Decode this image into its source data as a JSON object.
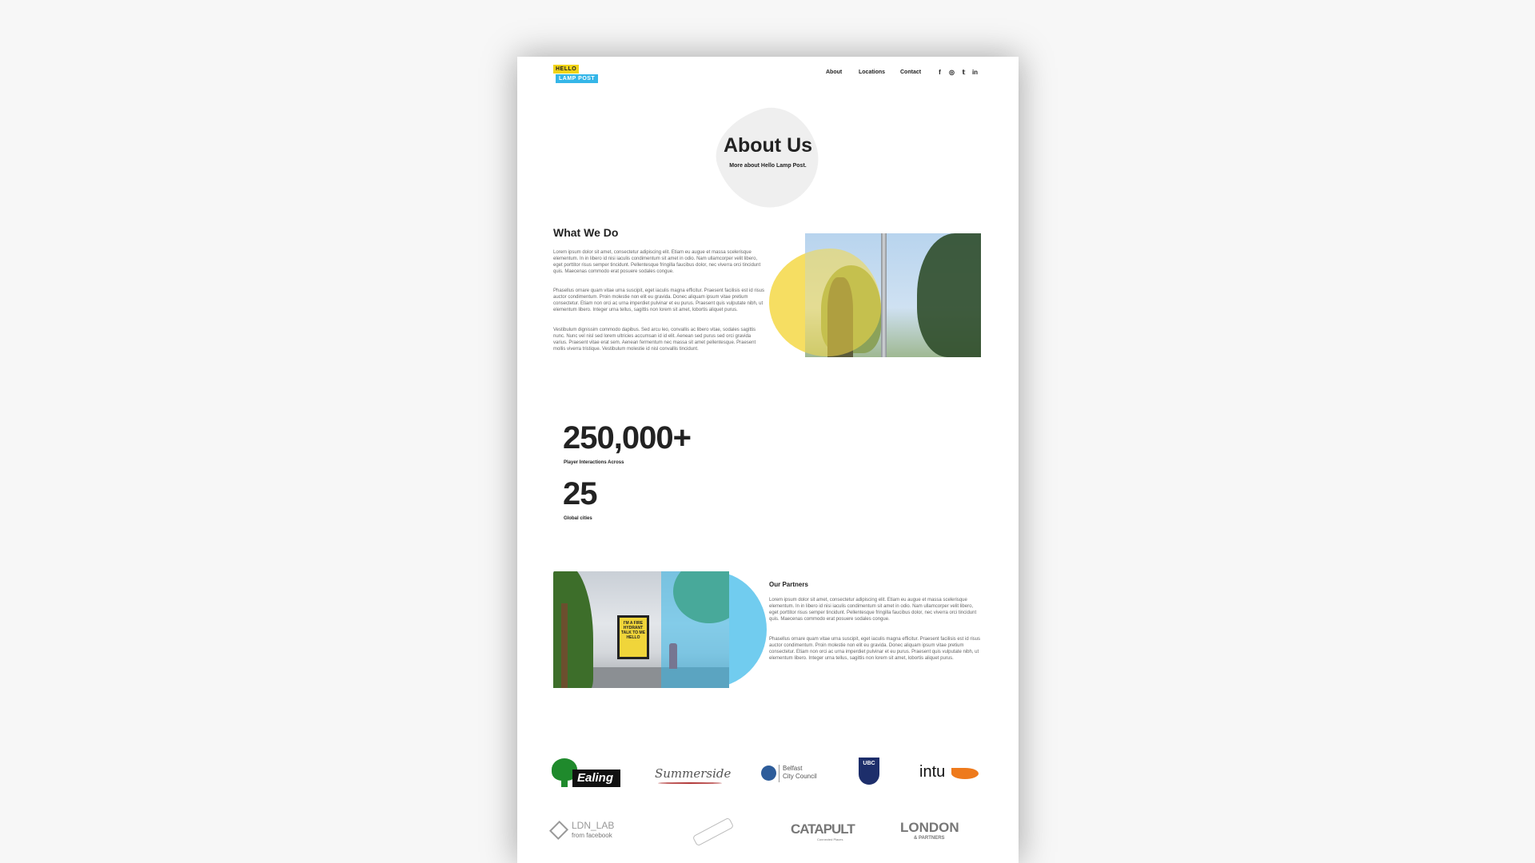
{
  "header": {
    "logo_line1": "HELLO",
    "logo_line2": "LAMP POST",
    "nav": [
      "About",
      "Locations",
      "Contact"
    ],
    "social_icons": [
      "facebook-icon",
      "instagram-icon",
      "twitter-icon",
      "linkedin-icon"
    ],
    "social_glyphs": [
      "f",
      "◎",
      "𝕥",
      "in"
    ]
  },
  "hero": {
    "title": "About Us",
    "subtitle": "More about Hello Lamp Post."
  },
  "what_we_do": {
    "heading": "What We Do",
    "paragraphs": [
      "Lorem ipsum dolor sit amet, consectetur adipiscing elit. Etiam eu augue et massa scelerisque elementum. In in libero id nisi iaculis condimentum sit amet in odio. Nam ullamcorper velit libero, eget porttitor risus semper tincidunt. Pellentesque fringilla faucibus dolor, nec viverra orci tincidunt quis. Maecenas commodo erat posuere sodales congue.",
      "Phasellus ornare quam vitae urna suscipit, eget iaculis magna efficitur. Praesent facilisis est id risus auctor condimentum. Proin molestie non elit eu gravida. Donec aliquam ipsum vitae pretium consectetur. Etiam non orci ac urna imperdiet pulvinar et eu purus. Praesent quis vulputate nibh, ut elementum libero. Integer urna tellus, sagittis non lorem sit amet, lobortis aliquet purus.",
      "Vestibulum dignissim commodo dapibus. Sed arcu leo, convallis ac libero vitae, sodales sagittis nunc. Nunc vel nisl sed lorem ultricies accumsan id id elit. Aenean sed purus sed orci gravida varius. Praesent vitae erat sem. Aenean fermentum nec massa sit amet pellentesque. Praesent mollis viverra tristique. Vestibulum molestie id nisl convallis tincidunt."
    ]
  },
  "stats": [
    {
      "value": "250,000+",
      "label": "Player Interactions Across"
    },
    {
      "value": "25",
      "label": "Global cities"
    }
  ],
  "partners": {
    "heading": "Our Partners",
    "sign_text": "I'M A FIRE HYDRANT TALK TO ME HELLO",
    "paragraphs": [
      "Lorem ipsum dolor sit amet, consectetur adipiscing elit. Etiam eu augue et massa scelerisque elementum. In in libero id nisi iaculis condimentum sit amet in odio. Nam ullamcorper velit libero, eget porttitor risus semper tincidunt. Pellentesque fringilla faucibus dolor, nec viverra orci tincidunt quis. Maecenas commodo erat posuere sodales congue.",
      "Phasellus ornare quam vitae urna suscipit, eget iaculis magna efficitur. Praesent facilisis est id risus auctor condimentum. Proin molestie non elit eu gravida. Donec aliquam ipsum vitae pretium consectetur. Etiam non orci ac urna imperdiet pulvinar et eu purus. Praesent quis vulputate nibh, ut elementum libero. Integer urna tellus, sagittis non lorem sit amet, lobortis aliquet purus."
    ]
  },
  "partner_logos": {
    "ealing": "Ealing",
    "summerside": "Summerside",
    "belfast_1": "Belfast",
    "belfast_2": "City Council",
    "ubc": "UBC",
    "intu": "intu",
    "ldn_lab_1": "LDN_LAB",
    "ldn_lab_2": "from facebook",
    "catapult": "CATAPULT",
    "catapult_sub": "Connected Places",
    "london_1": "LONDON",
    "london_2": "& PARTNERS"
  },
  "colors": {
    "brand_yellow": "#f2d418",
    "brand_blue": "#35b6e8"
  }
}
